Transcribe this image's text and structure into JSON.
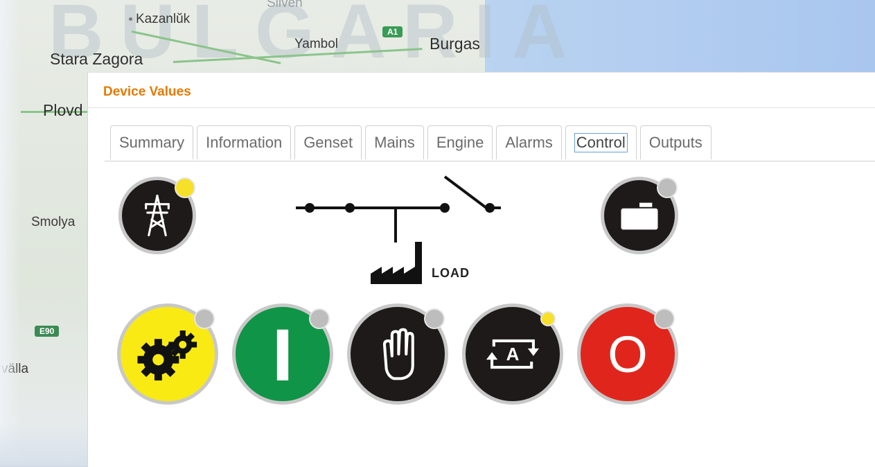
{
  "map": {
    "watermark": "BULGARIA",
    "cities": [
      {
        "name": "Sliven"
      },
      {
        "name": "Kazanlŭk"
      },
      {
        "name": "Yambol"
      },
      {
        "name": "Burgas"
      },
      {
        "name": "Stara Zagora"
      },
      {
        "name": "Plovd"
      },
      {
        "name": "Smolya"
      },
      {
        "name": "välla"
      }
    ],
    "roads": [
      {
        "label": "A1"
      },
      {
        "label": "E90"
      }
    ]
  },
  "panel": {
    "title": "Device Values",
    "title_color": "#e57a00"
  },
  "tabs": [
    {
      "label": "Summary",
      "active": false
    },
    {
      "label": "Information",
      "active": false
    },
    {
      "label": "Genset",
      "active": false
    },
    {
      "label": "Mains",
      "active": false
    },
    {
      "label": "Engine",
      "active": false
    },
    {
      "label": "Alarms",
      "active": false
    },
    {
      "label": "Control",
      "active": true
    },
    {
      "label": "Outputs",
      "active": false
    }
  ],
  "diagram": {
    "load_label": "LOAD"
  },
  "controls": {
    "mains_breaker": {
      "icon": "power-pylon-icon",
      "indicator": "on",
      "color": "#1e1a1a"
    },
    "genset_breaker": {
      "icon": "generator-icon",
      "indicator": "off",
      "color": "#1e1a1a"
    },
    "test_mode": {
      "icon": "gears-icon",
      "indicator": "off",
      "color": "#f9ea14"
    },
    "start": {
      "icon": "start-icon",
      "text": "I",
      "indicator": "off",
      "color": "#109447"
    },
    "manual_mode": {
      "icon": "hand-icon",
      "indicator": "off",
      "color": "#1e1a1a"
    },
    "auto_mode": {
      "icon": "auto-icon",
      "text": "A",
      "indicator": "on",
      "color": "#1e1a1a"
    },
    "stop": {
      "icon": "stop-icon",
      "text": "O",
      "indicator": "off",
      "color": "#e0261c"
    }
  }
}
